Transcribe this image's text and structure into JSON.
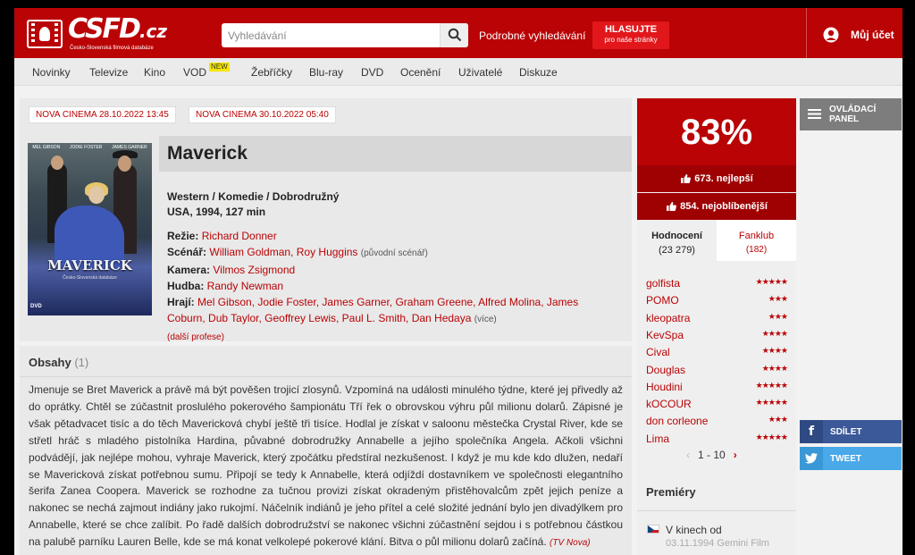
{
  "header": {
    "logo_text": "CSFD",
    "logo_tld": ".cz",
    "logo_sub": "Česko-Slovenská filmová databáze",
    "search_placeholder": "Vyhledávání",
    "advanced_search": "Podrobné vyhledávání",
    "vote_line1": "HLASUJTE",
    "vote_line2": "pro naše stránky",
    "account": "Můj účet"
  },
  "nav": {
    "items": [
      "Novinky",
      "Televize",
      "Kino",
      "VOD",
      "Žebříčky",
      "Blu-ray",
      "DVD",
      "Ocenění",
      "Uživatelé",
      "Diskuze"
    ],
    "vod_badge": "NEW"
  },
  "tv": [
    "NOVA CINEMA 28.10.2022 13:45",
    "NOVA CINEMA 30.10.2022 05:40"
  ],
  "poster": {
    "actors": [
      "MEL GIBSON",
      "JODIE FOSTER",
      "JAMES GARNER"
    ],
    "title": "MAVERICK",
    "subtitle": "Česko-Slovenská databáze",
    "label": "DVD"
  },
  "film": {
    "title": "Maverick",
    "genres": "Western / Komedie / Dobrodružný",
    "origin": "USA, 1994, 127 min",
    "director_label": "Režie:",
    "director": "Richard Donner",
    "writers_label": "Scénář:",
    "writers": "William Goldman, Roy Huggins",
    "writers_note": "(původní scénář)",
    "camera_label": "Kamera:",
    "camera": "Vilmos Zsigmond",
    "music_label": "Hudba:",
    "music": "Randy Newman",
    "cast_label": "Hrají:",
    "cast": "Mel Gibson, Jodie Foster, James Garner, Graham Greene, Alfred Molina, James Coburn, Dub Taylor, Geoffrey Lewis, Paul L. Smith, Dan Hedaya",
    "cast_more": "(více)",
    "more_professions": "(další profese)"
  },
  "plot": {
    "heading": "Obsahy",
    "count": "(1)",
    "text": "Jmenuje se Bret Maverick a právě má být pověšen trojicí zlosynů. Vzpomíná na události minulého týdne, které jej přivedly až do oprátky. Chtěl se zúčastnit proslulého pokerového šampionátu Tří řek o obrovskou výhru půl milionu dolarů. Zápisné je však pětadvacet tisíc a do těch Mavericková chybí ještě tři tisíce. Hodlal je získat v saloonu městečka Crystal River, kde se střetl hráč s mladého pistolníka Hardina, půvabné dobrodružky Annabelle a jejího společníka Angela. Ačkoli všichni podvádějí, jak nejlépe mohou, vyhraje Maverick, který zpočátku předstíral nezkušenost. I když je mu kde kdo dlužen, nedaří se Mavericková získat potřebnou sumu. Připojí se tedy k Annabelle, která odjíždí dostavníkem ve společnosti elegantního šerifa Zanea Coopera. Maverick se rozhodne za tučnou provizi získat okradeným přistěhovalcům zpět jejich peníze a nakonec se nechá zajmout indiány jako rukojmí. Náčelník indiánů je jeho přítel a celé složité jednání bylo jen divadýlkem pro Annabelle, které se chce zalíbit. Po řadě dalších dobrodružství se nakonec všichni zúčastnění sejdou i s potřebnou částkou na palubě parníku Lauren Belle, kde se má konat velkolepé pokerové klání. Bitva o půl milionu dolarů začíná.",
    "source": "(TV Nova)"
  },
  "rating": {
    "percent": "83%",
    "rank_best": "673. nejlepší",
    "rank_popular": "854. nejoblíbenější",
    "tab_ratings": "Hodnocení",
    "tab_ratings_count": "(23 279)",
    "tab_fanclub": "Fanklub",
    "tab_fanclub_count": "(182)",
    "color": "#ba0305"
  },
  "users": [
    {
      "name": "golfista",
      "stars": 5
    },
    {
      "name": "POMO",
      "stars": 3
    },
    {
      "name": "kleopatra",
      "stars": 3
    },
    {
      "name": "KevSpa",
      "stars": 4
    },
    {
      "name": "Cival",
      "stars": 4
    },
    {
      "name": "Douglas",
      "stars": 4
    },
    {
      "name": "Houdini",
      "stars": 5
    },
    {
      "name": "kOCOUR",
      "stars": 5
    },
    {
      "name": "don corleone",
      "stars": 3
    },
    {
      "name": "Lima",
      "stars": 5
    }
  ],
  "pager": {
    "range": "1 - 10"
  },
  "premiery": {
    "heading": "Premiéry",
    "cinema": "V kinech od",
    "date": "03.11.1994 Gemini Film"
  },
  "side": {
    "panel": "OVLÁDACÍ\nPANEL",
    "share": "SDÍLET",
    "tweet": "TWEET"
  }
}
